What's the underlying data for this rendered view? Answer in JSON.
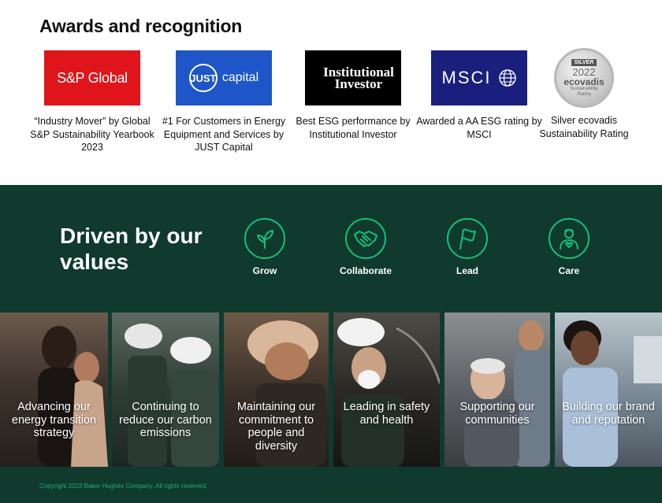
{
  "awards": {
    "title": "Awards and recognition",
    "items": [
      {
        "logo_text": "S&P Global",
        "caption": "“Industry Mover” by Global S&P Sustainability Yearbook 2023"
      },
      {
        "logo_mark": "JUST",
        "logo_text": "capital",
        "caption": "#1 For Customers in Energy Equipment and Services by JUST Capital"
      },
      {
        "logo_line1": "Institutional",
        "logo_line2": "Investor",
        "caption": "Best ESG performance by Institutional Investor"
      },
      {
        "logo_text": "MSCI",
        "caption": "Awarded a AA ESG rating by MSCI"
      },
      {
        "badge_label": "SILVER",
        "badge_year": "2022",
        "badge_name": "ecovadis",
        "badge_sub1": "Sustainability",
        "badge_sub2": "Rating",
        "caption": "Silver ecovadis Sustainability Rating"
      }
    ],
    "colors": {
      "sp": "#e0151b",
      "just": "#1e55c8",
      "ii": "#000000",
      "msci": "#1a1f7e"
    }
  },
  "values": {
    "title": "Driven by our values",
    "items": [
      {
        "label": "Grow",
        "icon": "sprout-icon"
      },
      {
        "label": "Collaborate",
        "icon": "handshake-icon"
      },
      {
        "label": "Lead",
        "icon": "flag-icon"
      },
      {
        "label": "Care",
        "icon": "person-heart-icon"
      }
    ],
    "accent": "#13c17a",
    "background": "#0f3a2d"
  },
  "tiles": [
    {
      "text": "Advancing our energy transition strategy"
    },
    {
      "text": "Continuing to reduce our carbon emissions"
    },
    {
      "text": "Maintaining our commitment to people and diversity"
    },
    {
      "text": "Leading in safety and health"
    },
    {
      "text": "Supporting our communities"
    },
    {
      "text": "Building our brand and reputation"
    }
  ],
  "footer": {
    "copyright": "Copyright 2023 Baker Hughes Company. All rights reserved."
  }
}
